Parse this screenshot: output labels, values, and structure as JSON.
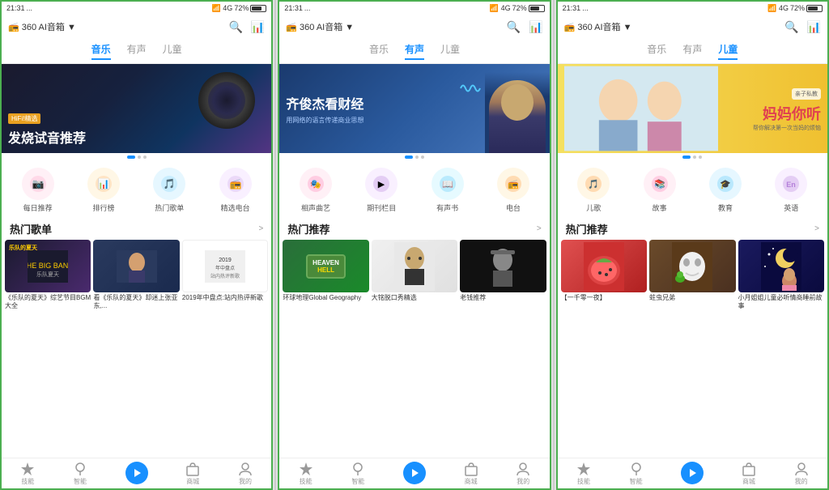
{
  "panels": [
    {
      "id": "music",
      "status": {
        "time": "21:31",
        "battery": "72%",
        "network": "4G"
      },
      "app_title": "360 AI音箱 ▼",
      "tabs": [
        {
          "label": "音乐",
          "active": true
        },
        {
          "label": "有声",
          "active": false
        },
        {
          "label": "儿童",
          "active": false
        }
      ],
      "banner": {
        "type": "music",
        "badge": "HiFi!精选",
        "title": "发烧试音推荐"
      },
      "categories": [
        {
          "icon": "📷",
          "color": "#ff7eb3",
          "bg": "#fff0f6",
          "label": "每日推荐"
        },
        {
          "icon": "📊",
          "color": "#ff9a3c",
          "bg": "#fff7e6",
          "label": "排行榜"
        },
        {
          "icon": "🎵",
          "color": "#52c8fa",
          "bg": "#e6f7ff",
          "label": "热门歌单"
        },
        {
          "icon": "📻",
          "color": "#b47fda",
          "bg": "#f9f0ff",
          "label": "精选电台"
        }
      ],
      "section": {
        "title": "热门歌单",
        "more": ">"
      },
      "items": [
        {
          "type": "music1",
          "title": "《乐队的夏天》综艺节目BGM大全"
        },
        {
          "type": "music2",
          "title": "看《乐队的夏天》却迷上张亚东,..."
        },
        {
          "type": "music3",
          "title": "2019年中盘点:站内热评新歌"
        }
      ],
      "nav": [
        {
          "icon": "💎",
          "label": "技能",
          "active": false
        },
        {
          "icon": "💡",
          "label": "智能",
          "active": false
        },
        {
          "icon": "▶",
          "label": "",
          "active": true,
          "special": true
        },
        {
          "icon": "🏪",
          "label": "商城",
          "active": false
        },
        {
          "icon": "👤",
          "label": "我的",
          "active": false
        }
      ]
    },
    {
      "id": "podcast",
      "status": {
        "time": "21:31",
        "battery": "72%",
        "network": "4G"
      },
      "app_title": "360 AI音箱 ▼",
      "tabs": [
        {
          "label": "音乐",
          "active": false
        },
        {
          "label": "有声",
          "active": true
        },
        {
          "label": "儿童",
          "active": false
        }
      ],
      "banner": {
        "type": "podcast",
        "title": "齐俊杰看财经",
        "subtitle": "用网络的语言传递商业思想"
      },
      "categories": [
        {
          "icon": "🎭",
          "color": "#ff7eb3",
          "bg": "#fff0f6",
          "label": "相声曲艺"
        },
        {
          "icon": "📺",
          "color": "#b47fda",
          "bg": "#f9f0ff",
          "label": "期刊栏目"
        },
        {
          "icon": "📖",
          "color": "#52c8fa",
          "bg": "#e6faff",
          "label": "有声书"
        },
        {
          "icon": "📻",
          "color": "#ff9a3c",
          "bg": "#fff7e6",
          "label": "电台"
        }
      ],
      "section": {
        "title": "热门推荐",
        "more": ">"
      },
      "items": [
        {
          "type": "geo",
          "title": "环球地理Global Geography"
        },
        {
          "type": "talk",
          "title": "大铭脱口秀精选"
        },
        {
          "type": "old",
          "title": "老钱推荐"
        }
      ],
      "nav": [
        {
          "icon": "💎",
          "label": "技能",
          "active": false
        },
        {
          "icon": "💡",
          "label": "智能",
          "active": false
        },
        {
          "icon": "▶",
          "label": "",
          "active": true,
          "special": true
        },
        {
          "icon": "🏪",
          "label": "商城",
          "active": false
        },
        {
          "icon": "👤",
          "label": "我的",
          "active": false
        }
      ]
    },
    {
      "id": "kids",
      "status": {
        "time": "21:31",
        "battery": "72%",
        "network": "4G"
      },
      "app_title": "360 AI音箱 ▼",
      "tabs": [
        {
          "label": "音乐",
          "active": false
        },
        {
          "label": "有声",
          "active": false
        },
        {
          "label": "儿童",
          "active": true
        }
      ],
      "banner": {
        "type": "kids",
        "badge": "亲子私教",
        "title": "妈妈你听",
        "subtitle": "帮你解决第一次当妈的烦恼"
      },
      "categories": [
        {
          "icon": "🎵",
          "color": "#ff9a3c",
          "bg": "#fff7e6",
          "label": "儿歌"
        },
        {
          "icon": "📚",
          "color": "#ff7eb3",
          "bg": "#fff0f6",
          "label": "故事"
        },
        {
          "icon": "🎓",
          "color": "#52c8fa",
          "bg": "#e6f7ff",
          "label": "教育"
        },
        {
          "icon": "En",
          "color": "#b47fda",
          "bg": "#f9f0ff",
          "label": "英语"
        }
      ],
      "section": {
        "title": "热门推荐",
        "more": ">"
      },
      "items": [
        {
          "type": "night",
          "title": "【一千零一夜】"
        },
        {
          "type": "tooth",
          "title": "蛀虫兄弟"
        },
        {
          "type": "moon",
          "title": "小月姐姐儿童必听情商睡前故事"
        }
      ],
      "nav": [
        {
          "icon": "💎",
          "label": "技能",
          "active": false
        },
        {
          "icon": "💡",
          "label": "智能",
          "active": false
        },
        {
          "icon": "▶",
          "label": "",
          "active": true,
          "special": true
        },
        {
          "icon": "🏪",
          "label": "商城",
          "active": false
        },
        {
          "icon": "👤",
          "label": "我的",
          "active": false
        }
      ]
    }
  ]
}
